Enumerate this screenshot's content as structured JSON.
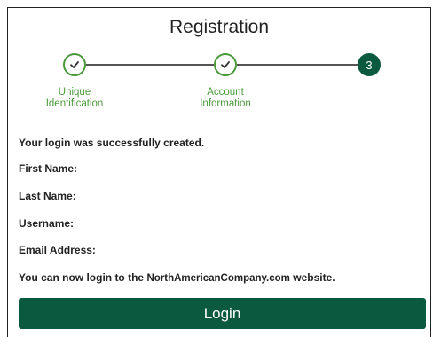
{
  "header": {
    "title": "Registration"
  },
  "stepper": {
    "steps": [
      {
        "label_line1": "Unique",
        "label_line2": "Identification",
        "status": "complete"
      },
      {
        "label_line1": "Account",
        "label_line2": "Information",
        "status": "complete"
      },
      {
        "number": "3",
        "status": "current"
      }
    ],
    "complete_color": "#4a9a3b",
    "current_color": "#0b5a3f"
  },
  "content": {
    "success_message": "Your login was successfully created.",
    "first_name_label": "First Name:",
    "last_name_label": "Last Name:",
    "username_label": "Username:",
    "email_label": "Email Address:",
    "login_prompt_prefix": "You can now login to the ",
    "login_prompt_domain": "NorthAmericanCompany.com",
    "login_prompt_suffix": " website."
  },
  "actions": {
    "login_label": "Login",
    "button_color": "#0b5a3f"
  }
}
